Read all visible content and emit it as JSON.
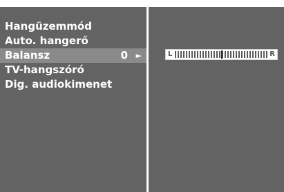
{
  "menu": {
    "items": [
      {
        "label": "Hangüzemmód"
      },
      {
        "label": "Auto. hangerő"
      },
      {
        "label": "Balansz",
        "value": "0",
        "arrow": "►",
        "selected": true
      },
      {
        "label": "TV-hangszóró"
      },
      {
        "label": "Dig. audiokimenet"
      }
    ]
  },
  "balance": {
    "left_label": "L",
    "right_label": "R",
    "min": -50,
    "max": 50,
    "value": 0
  }
}
